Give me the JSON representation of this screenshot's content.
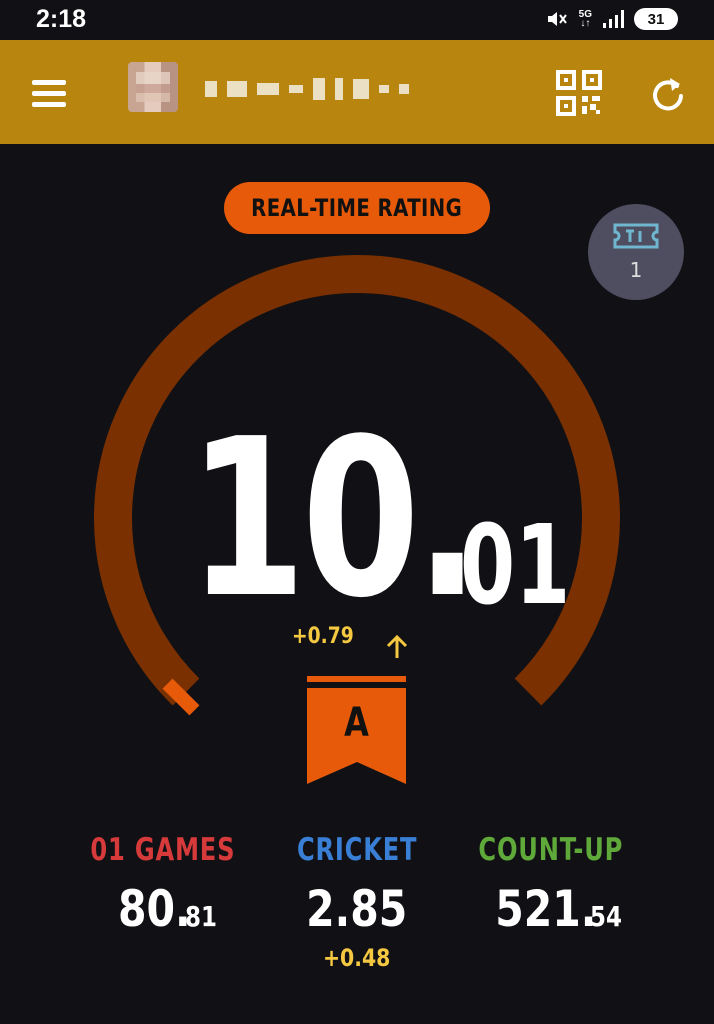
{
  "status_bar": {
    "time": "2:18",
    "network": "5G",
    "battery": "31"
  },
  "header": {
    "menu_icon": "hamburger-menu-icon",
    "qr_icon": "qr-code-icon",
    "refresh_icon": "refresh-icon"
  },
  "rating": {
    "pill_label": "REAL-TIME RATING",
    "value_int": "10.",
    "value_dec": "01",
    "delta": "+0.79",
    "gauge_fraction": 0.0,
    "class_letter": "A"
  },
  "ticket": {
    "count": "1",
    "icon": "ticket-icon"
  },
  "stats": [
    {
      "label": "01 GAMES",
      "value_int": "80.",
      "value_dec": "81",
      "delta": "",
      "color": "#d63a3a"
    },
    {
      "label": "CRICKET",
      "value_int": "2.85",
      "value_dec": "",
      "delta": "+0.48",
      "color": "#3a7fd6"
    },
    {
      "label": "COUNT-UP",
      "value_int": "521.",
      "value_dec": "54",
      "delta": "",
      "color": "#5fa83a"
    }
  ],
  "colors": {
    "header_bg": "#b8860e",
    "accent_orange": "#e65a0a",
    "gauge_track": "#7a3000",
    "delta_yellow": "#f5c842"
  }
}
